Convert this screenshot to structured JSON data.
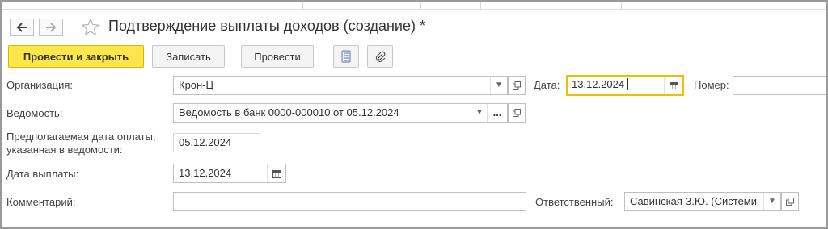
{
  "window": {
    "title": "Подтверждение выплаты доходов (создание) *",
    "favorite_icon": "star-icon"
  },
  "toolbar": {
    "post_close_label": "Провести и закрыть",
    "save_label": "Записать",
    "post_label": "Провести",
    "report_icon": "document-list-icon",
    "attach_icon": "paperclip-icon"
  },
  "form": {
    "organization": {
      "label": "Организация:",
      "value": "Крон-Ц"
    },
    "date": {
      "label": "Дата:",
      "value": "13.12.2024"
    },
    "number": {
      "label": "Номер:",
      "value": ""
    },
    "statement": {
      "label": "Ведомость:",
      "value": "Ведомость в банк 0000-000010 от 05.12.2024",
      "select_button": "..."
    },
    "expected_date": {
      "label_line1": "Предполагаемая дата оплаты,",
      "label_line2": "указанная в ведомости:",
      "value": "05.12.2024"
    },
    "payment_date": {
      "label": "Дата выплаты:",
      "value": "13.12.2024"
    },
    "comment": {
      "label": "Комментарий:",
      "value": ""
    },
    "responsible": {
      "label": "Ответственный:",
      "value": "Савинская З.Ю. (Системи"
    }
  },
  "colors": {
    "accent": "#fde64b",
    "focus_border": "#f0c000",
    "border": "#bfbfbf"
  }
}
